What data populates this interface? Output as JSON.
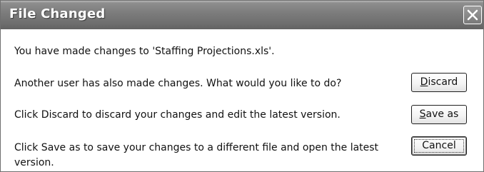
{
  "dialog": {
    "title": "File Changed",
    "close_icon": "close-icon"
  },
  "messages": {
    "line1": "You have made changes to 'Staffing Projections.xls'.",
    "line2": "Another user has also made changes. What would you like to do?",
    "line3": "Click Discard to discard your changes and edit the latest version.",
    "line4": "Click Save as to save your changes to a different file and open the latest version."
  },
  "buttons": {
    "discard": {
      "accel": "D",
      "rest": "iscard"
    },
    "save_as": {
      "accel": "S",
      "rest": "ave as"
    },
    "cancel": {
      "label": "Cancel"
    }
  }
}
